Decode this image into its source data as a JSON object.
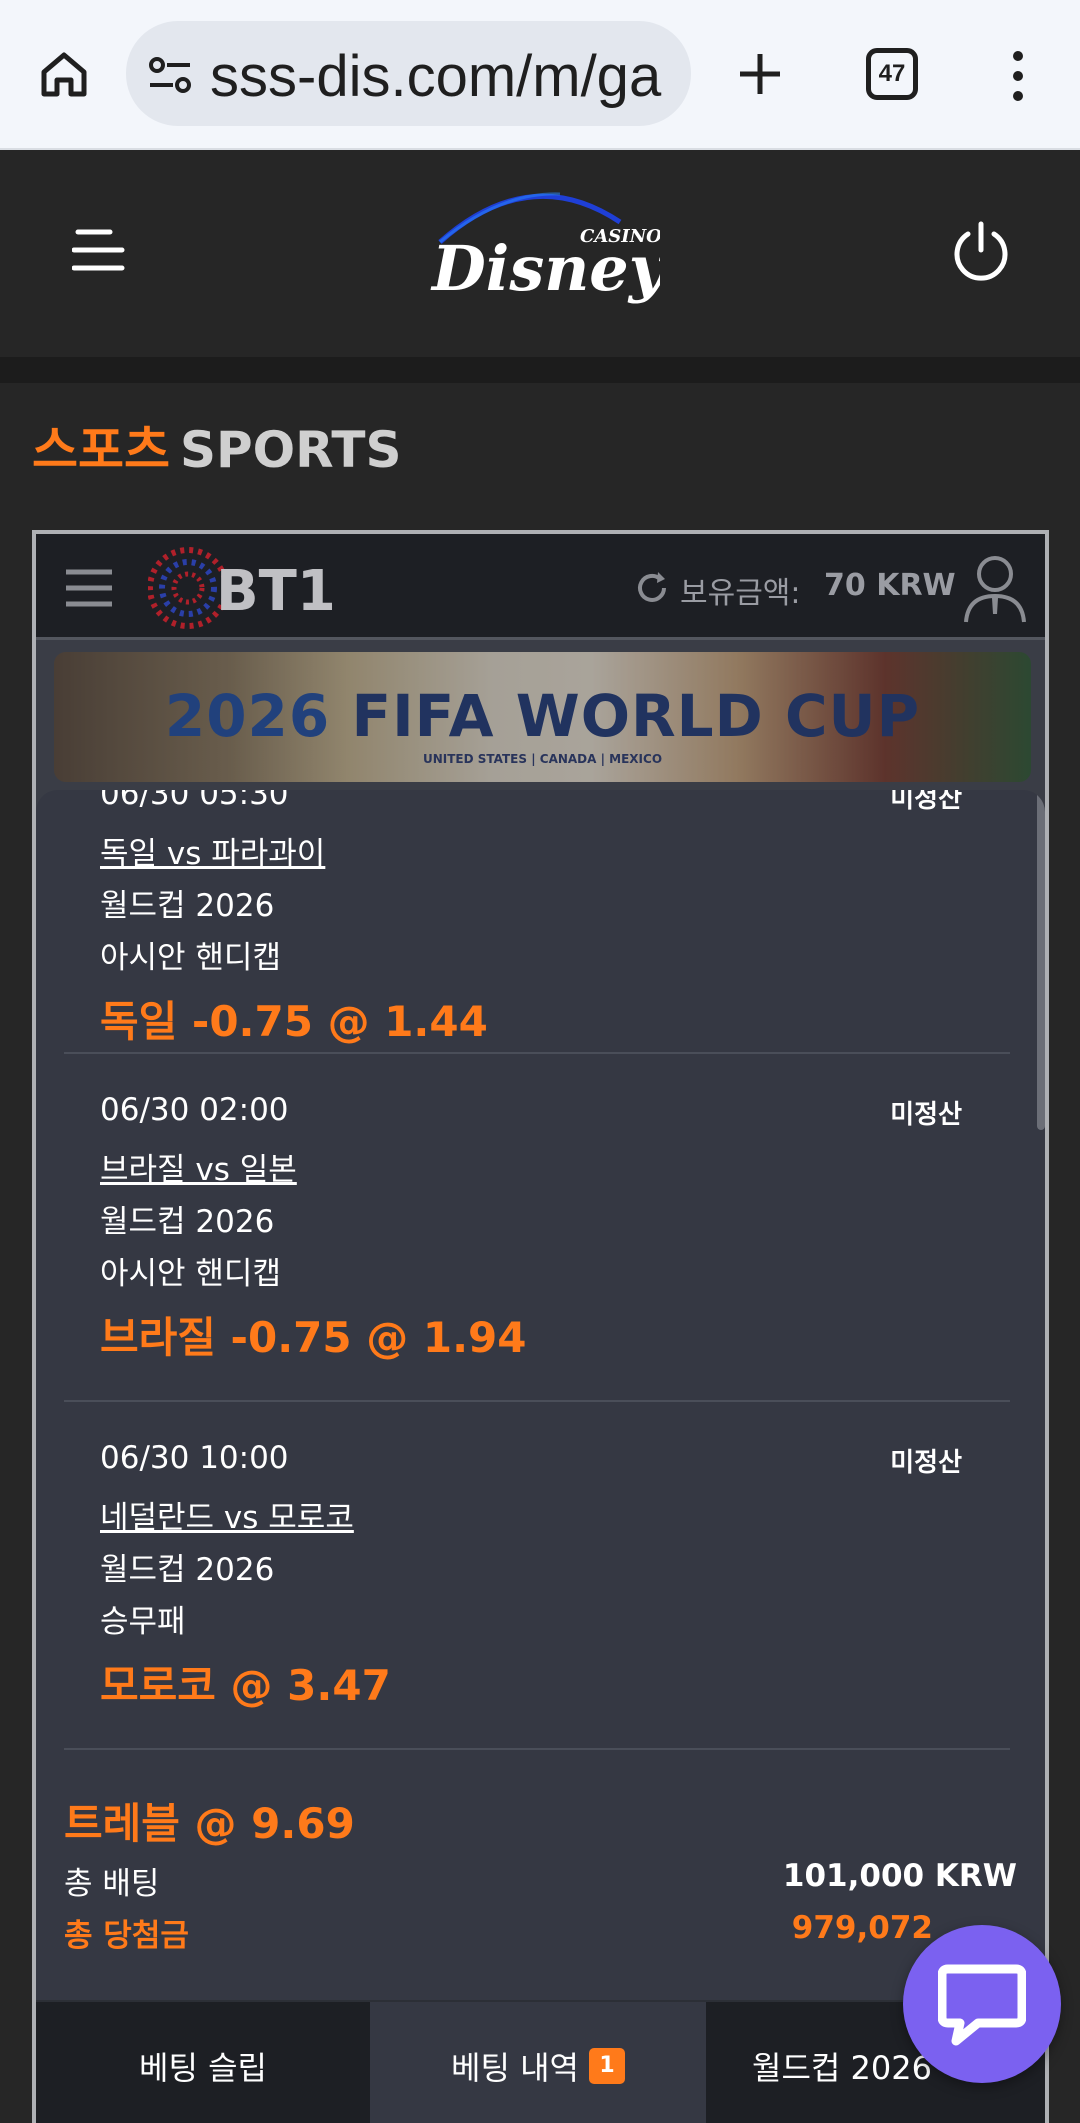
{
  "browser": {
    "url": "sss-dis.com/m/ga",
    "tab_count": "47"
  },
  "site": {
    "logo_text": "Disney",
    "logo_sub": "CASINO"
  },
  "section": {
    "title_ko": "스포츠",
    "title_en": "SPORTS"
  },
  "bt1": {
    "logo_text": "BT1",
    "balance_label": "보유금액:",
    "balance_value": "70 KRW"
  },
  "banner": {
    "year": "2026",
    "title": "FIFA WORLD CUP",
    "subtitle": "UNITED STATES | CANADA | MEXICO"
  },
  "bets": [
    {
      "time": "06/30 05:30",
      "status": "미정산",
      "match": "독일 vs 파라과이",
      "league": "월드컵 2026",
      "market": "아시안 핸디캡",
      "pick": "독일 -0.75 @ 1.44"
    },
    {
      "time": "06/30 02:00",
      "status": "미정산",
      "match": "브라질 vs 일본",
      "league": "월드컵 2026",
      "market": "아시안 핸디캡",
      "pick": "브라질 -0.75 @ 1.94"
    },
    {
      "time": "06/30 10:00",
      "status": "미정산",
      "match": "네덜란드 vs 모로코",
      "league": "월드컵 2026",
      "market": "승무패",
      "pick": "모로코 @ 3.47"
    }
  ],
  "summary": {
    "combo": "트레블 @ 9.69",
    "total_bet_label": "총 배팅",
    "total_bet_value": "101,000 KRW",
    "total_win_label": "총 당첨금",
    "total_win_value": "979,072"
  },
  "tabs": [
    {
      "label": "베팅 슬립"
    },
    {
      "label": "베팅 내역",
      "badge": "1"
    },
    {
      "label": "월드컵 2026"
    }
  ],
  "colors": {
    "accent": "#ff7a1a",
    "panel": "#353843",
    "chat": "#7b61f0"
  }
}
